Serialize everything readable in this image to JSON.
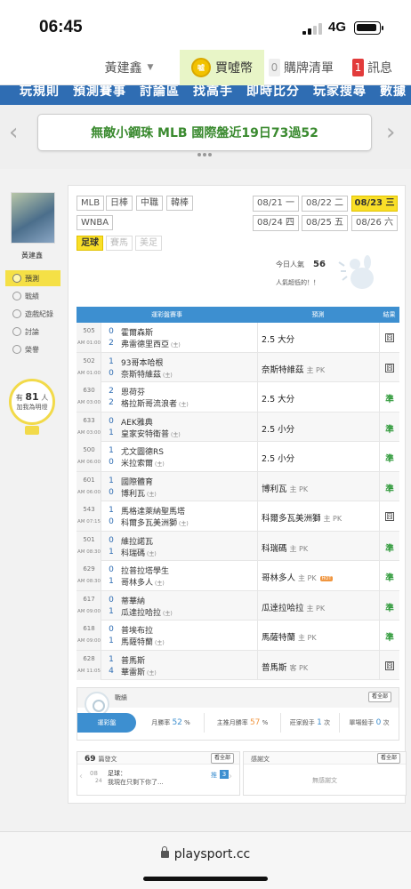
{
  "status_bar": {
    "time": "06:45",
    "network": "4G"
  },
  "topnav": {
    "username": "黃建鑫",
    "coin_label": "買噓幣",
    "coin_icon_text": "噓",
    "cart_count": "0",
    "cart_label": "購牌清單",
    "msg_count": "1",
    "msg_label": "訊息"
  },
  "blue_nav_text": "玩規則　預測賽事　討論區　找高手　即時比分　玩家搜尋　數據",
  "banner": {
    "text": "無敵小鋼珠 MLB 國際盤近19日73過52",
    "prev": "‹",
    "next": "›"
  },
  "sidebar": {
    "name": "黃建鑫",
    "items": [
      "預測",
      "戰績",
      "遊戲紀錄",
      "討論",
      "榮譽"
    ],
    "bulb_prefix": "有",
    "bulb_count": "81",
    "bulb_suffix": "人",
    "bulb_line2": "加我為明燈"
  },
  "sports": {
    "row1": [
      "MLB",
      "日棒",
      "中職",
      "韓棒"
    ],
    "row2": [
      "WNBA"
    ],
    "row3": [
      "足球",
      "賽馬",
      "美足"
    ]
  },
  "dates": [
    {
      "date": "08/21",
      "dow": "一"
    },
    {
      "date": "08/22",
      "dow": "二"
    },
    {
      "date": "08/23",
      "dow": "三"
    },
    {
      "date": "08/24",
      "dow": "四"
    },
    {
      "date": "08/25",
      "dow": "五"
    },
    {
      "date": "08/26",
      "dow": "六"
    }
  ],
  "popularity": {
    "label": "今日人氣",
    "value": "56",
    "note": "人氣超低的！！"
  },
  "table": {
    "headers": [
      "運彩盤賽事",
      "預測",
      "結果"
    ],
    "rows": [
      {
        "num": "505",
        "time": "AM 01:00",
        "s1": "0",
        "s2": "2",
        "t1": "霍爾森斯",
        "t2": "弗雷德里西亞",
        "home": "(主)",
        "pred": "2.5 大分",
        "sub": "",
        "hot": "",
        "res": "lose",
        "res_text": "囧"
      },
      {
        "num": "502",
        "time": "AM 01:00",
        "s1": "1",
        "s2": "0",
        "t1": "93哥本哈根",
        "t2": "奈斯特維茲",
        "home": "(主)",
        "pred": "奈斯特維茲",
        "sub": "主 PK",
        "hot": "",
        "res": "lose",
        "res_text": "囧"
      },
      {
        "num": "630",
        "time": "AM 03:00",
        "s1": "2",
        "s2": "2",
        "t1": "恩荷芬",
        "t2": "格拉斯哥流浪者",
        "home": "(主)",
        "pred": "2.5 大分",
        "sub": "",
        "hot": "",
        "res": "win",
        "res_text": "準"
      },
      {
        "num": "633",
        "time": "AM 03:00",
        "s1": "0",
        "s2": "1",
        "t1": "AEK雅典",
        "t2": "皇家安特衛普",
        "home": "(主)",
        "pred": "2.5 小分",
        "sub": "",
        "hot": "",
        "res": "win",
        "res_text": "準"
      },
      {
        "num": "500",
        "time": "AM 06:00",
        "s1": "1",
        "s2": "0",
        "t1": "尤文圖德RS",
        "t2": "米拉索爾",
        "home": "(主)",
        "pred": "2.5 小分",
        "sub": "",
        "hot": "",
        "res": "win",
        "res_text": "準"
      },
      {
        "num": "601",
        "time": "AM 06:00",
        "s1": "1",
        "s2": "0",
        "t1": "國際體育",
        "t2": "博利瓦",
        "home": "(主)",
        "pred": "博利瓦",
        "sub": "主 PK",
        "hot": "",
        "res": "win",
        "res_text": "準"
      },
      {
        "num": "543",
        "time": "AM 07:15",
        "s1": "1",
        "s2": "0",
        "t1": "馬格達萊納聖馬塔",
        "t2": "科爾多瓦美洲獅",
        "home": "(主)",
        "pred": "科爾多瓦美洲獅",
        "sub": "主 PK",
        "hot": "",
        "res": "lose",
        "res_text": "囧"
      },
      {
        "num": "501",
        "time": "AM 08:30",
        "s1": "0",
        "s2": "1",
        "t1": "維拉諾瓦",
        "t2": "科瑞碼",
        "home": "(主)",
        "pred": "科瑞碼",
        "sub": "主 PK",
        "hot": "",
        "res": "win",
        "res_text": "準"
      },
      {
        "num": "629",
        "time": "AM 08:30",
        "s1": "0",
        "s2": "1",
        "t1": "拉普拉塔學生",
        "t2": "哥林多人",
        "home": "(主)",
        "pred": "哥林多人",
        "sub": "主 PK",
        "hot": "HOT",
        "res": "win",
        "res_text": "準"
      },
      {
        "num": "617",
        "time": "AM 09:00",
        "s1": "0",
        "s2": "1",
        "t1": "蒂華納",
        "t2": "瓜達拉哈拉",
        "home": "(主)",
        "pred": "瓜達拉哈拉",
        "sub": "主 PK",
        "hot": "",
        "res": "win",
        "res_text": "準"
      },
      {
        "num": "618",
        "time": "AM 09:00",
        "s1": "0",
        "s2": "1",
        "t1": "普埃布拉",
        "t2": "馬薩特蘭",
        "home": "(主)",
        "pred": "馬薩特蘭",
        "sub": "主 PK",
        "hot": "",
        "res": "win",
        "res_text": "準"
      },
      {
        "num": "628",
        "time": "AM 11:05",
        "s1": "1",
        "s2": "4",
        "t1": "普馬斯",
        "t2": "華雷斯",
        "home": "(主)",
        "pred": "普馬斯",
        "sub": "客 PK",
        "hot": "",
        "res": "lose",
        "res_text": "囧"
      }
    ]
  },
  "record": {
    "title": "戰績",
    "view_all": "看全部",
    "main_label": "運彩盤",
    "stat1_label": "月勝率",
    "stat1_value": "52",
    "stat1_unit": "%",
    "stat2_label": "主推月勝率",
    "stat2_value": "57",
    "stat2_unit": "%",
    "stat3_label": "莊家殺手",
    "stat3_value": "1",
    "stat3_unit": "次",
    "stat4_label": "單場殺手",
    "stat4_value": "0",
    "stat4_unit": "次"
  },
  "posts": {
    "count": "69",
    "title": "篇發文",
    "view_all": "看全部",
    "item_date_m": "08",
    "item_date_d": "24",
    "item_title": "足球：",
    "item_text": "我現在只剩下你了...",
    "item_likes": "3",
    "item_like_prefix": "推"
  },
  "thanks": {
    "title": "感謝文",
    "view_all": "看全部",
    "empty": "無感謝文"
  },
  "browser": {
    "url": "playsport.cc"
  },
  "colors": {
    "accent_blue": "#3d8fd0",
    "highlight_yellow": "#f9df28",
    "win_green": "#2f9a3a",
    "banner_green": "#3a8a2f"
  }
}
